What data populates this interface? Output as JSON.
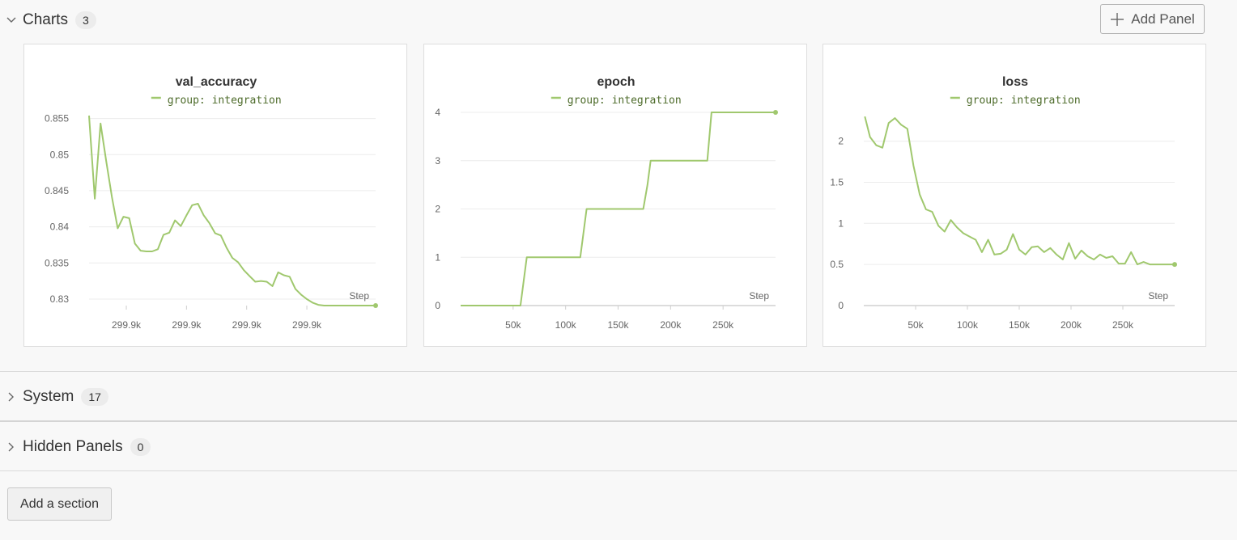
{
  "sections": {
    "charts": {
      "title": "Charts",
      "count": "3"
    },
    "system": {
      "title": "System",
      "count": "17"
    },
    "hidden": {
      "title": "Hidden Panels",
      "count": "0"
    }
  },
  "add_panel_label": "Add Panel",
  "add_section_label": "Add a section",
  "colors": {
    "series": "#a0c86e",
    "grid": "#ececec",
    "axis": "#e2e2e2"
  },
  "chart_data": [
    {
      "type": "line",
      "title": "val_accuracy",
      "legend": [
        "group: integration"
      ],
      "xlabel": "Step",
      "xlim": [
        0,
        100
      ],
      "ylim": [
        0.8291,
        0.8554
      ],
      "yticks": [
        0.855,
        0.85,
        0.845,
        0.84,
        0.835,
        0.83
      ],
      "ytick_labels": [
        "0.855",
        "0.85",
        "0.845",
        "0.84",
        "0.835",
        "0.83"
      ],
      "xticks": [
        13,
        34,
        55,
        76
      ],
      "xtick_labels": [
        "299.9k",
        "299.9k",
        "299.9k",
        "299.9k"
      ],
      "series": [
        {
          "name": "group: integration",
          "x": [
            0,
            2,
            4,
            6,
            8,
            10,
            12,
            14,
            16,
            18,
            20,
            22,
            24,
            26,
            28,
            30,
            32,
            34,
            36,
            38,
            40,
            42,
            44,
            46,
            48,
            50,
            52,
            54,
            56,
            58,
            60,
            62,
            64,
            66,
            68,
            70,
            72,
            74,
            76,
            78,
            80,
            82,
            84,
            86,
            88,
            90,
            92,
            94,
            96,
            98,
            100
          ],
          "y": [
            0.8554,
            0.8439,
            0.8543,
            0.8491,
            0.8441,
            0.8398,
            0.8414,
            0.8412,
            0.8377,
            0.8367,
            0.8366,
            0.8366,
            0.8369,
            0.8389,
            0.8392,
            0.8409,
            0.8401,
            0.8416,
            0.843,
            0.8432,
            0.8416,
            0.8405,
            0.8391,
            0.8388,
            0.8371,
            0.8357,
            0.8351,
            0.834,
            0.8332,
            0.8324,
            0.8325,
            0.8324,
            0.8318,
            0.8337,
            0.8333,
            0.8331,
            0.8314,
            0.8306,
            0.83,
            0.8295,
            0.8292,
            0.8291,
            0.8291,
            0.8291,
            0.8291,
            0.8291,
            0.8291,
            0.8291,
            0.8291,
            0.8291,
            0.8291
          ]
        }
      ]
    },
    {
      "type": "line",
      "title": "epoch",
      "legend": [
        "group: integration"
      ],
      "xlabel": "Step",
      "xlim": [
        0,
        300000
      ],
      "ylim": [
        0,
        4
      ],
      "yticks": [
        0,
        1,
        2,
        3,
        4
      ],
      "ytick_labels": [
        "0",
        "1",
        "2",
        "3",
        "4"
      ],
      "xticks": [
        50000,
        100000,
        150000,
        200000,
        250000
      ],
      "xtick_labels": [
        "50k",
        "100k",
        "150k",
        "200k",
        "250k"
      ],
      "series": [
        {
          "name": "group: integration",
          "x": [
            0,
            52000,
            57000,
            60000,
            63000,
            110000,
            114000,
            117000,
            120000,
            170000,
            174000,
            178000,
            181000,
            231000,
            235000,
            239000,
            300000
          ],
          "y": [
            0,
            0,
            0,
            0.5,
            1,
            1,
            1,
            1.5,
            2,
            2,
            2,
            2.5,
            3,
            3,
            3,
            4,
            4
          ]
        }
      ]
    },
    {
      "type": "line",
      "title": "loss",
      "legend": [
        "group: integration"
      ],
      "xlabel": "Step",
      "xlim": [
        0,
        300000
      ],
      "ylim": [
        0,
        2.35
      ],
      "yticks": [
        0,
        0.5,
        1,
        1.5,
        2
      ],
      "ytick_labels": [
        "0",
        "0.5",
        "1",
        "1.5",
        "2"
      ],
      "xticks": [
        50000,
        100000,
        150000,
        200000,
        250000
      ],
      "xtick_labels": [
        "50k",
        "100k",
        "150k",
        "200k",
        "250k"
      ],
      "series": [
        {
          "name": "group: integration",
          "x": [
            1000,
            6000,
            12000,
            18000,
            24000,
            30000,
            36000,
            42000,
            48000,
            54000,
            60000,
            66000,
            72000,
            78000,
            84000,
            90000,
            96000,
            102000,
            108000,
            114000,
            120000,
            126000,
            132000,
            138000,
            144000,
            150000,
            156000,
            162000,
            168000,
            174000,
            180000,
            186000,
            192000,
            198000,
            204000,
            210000,
            216000,
            222000,
            228000,
            234000,
            240000,
            246000,
            252000,
            258000,
            264000,
            270000,
            276000,
            282000,
            288000,
            294000,
            300000
          ],
          "y": [
            2.3,
            2.05,
            1.95,
            1.92,
            2.22,
            2.28,
            2.2,
            2.15,
            1.7,
            1.35,
            1.17,
            1.14,
            0.97,
            0.9,
            1.04,
            0.95,
            0.88,
            0.84,
            0.8,
            0.65,
            0.8,
            0.62,
            0.63,
            0.68,
            0.87,
            0.68,
            0.62,
            0.71,
            0.72,
            0.65,
            0.7,
            0.62,
            0.56,
            0.76,
            0.57,
            0.67,
            0.6,
            0.56,
            0.62,
            0.58,
            0.6,
            0.51,
            0.51,
            0.65,
            0.5,
            0.53,
            0.5,
            0.5,
            0.5,
            0.5,
            0.5
          ]
        }
      ]
    }
  ]
}
